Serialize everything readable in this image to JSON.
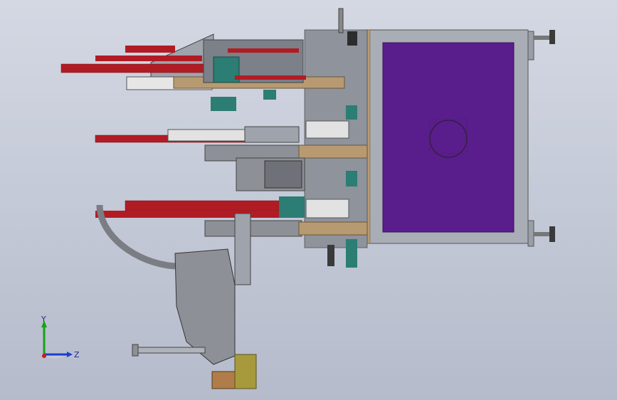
{
  "viewport": {
    "background_top": "#d4d8e3",
    "background_bottom": "#b5bbcb"
  },
  "colors": {
    "panel_purple": "#5a1d8c",
    "frame_grey": "#a9adb5",
    "cylinder_red": "#b11c24",
    "wood_tan": "#b89a72",
    "teal": "#2c7d73",
    "motor_grey": "#8d9096"
  },
  "triad": {
    "y_label": "Y",
    "z_label": "Z",
    "x_axis_color": "#d11a1a",
    "y_axis_color": "#1aa01a",
    "z_axis_color": "#1a3fd1"
  }
}
